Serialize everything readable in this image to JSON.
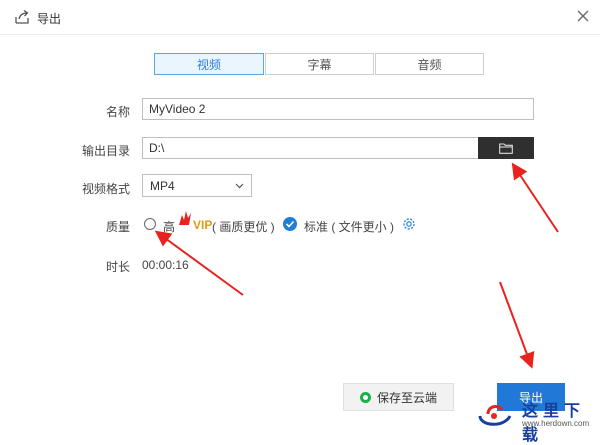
{
  "window": {
    "title": "导出",
    "close_icon": "close-icon",
    "title_icon": "export-icon"
  },
  "tabs": [
    {
      "label": "视频",
      "active": true
    },
    {
      "label": "字幕",
      "active": false
    },
    {
      "label": "音频",
      "active": false
    }
  ],
  "form": {
    "name_label": "名称",
    "name_value": "MyVideo 2",
    "dir_label": "输出目录",
    "dir_value": "D:\\",
    "format_label": "视频格式",
    "format_value": "MP4",
    "quality_label": "质量",
    "quality_high": "高",
    "quality_vip": "VIP",
    "quality_high_note": "( 画质更优 )",
    "quality_standard": "标准 ( 文件更小 )",
    "quality_selected": "standard",
    "duration_label": "时长",
    "duration_value": "00:00:16"
  },
  "footer": {
    "cloud_label": "保存至云端",
    "export_label": "导出"
  },
  "watermark": {
    "text": "这里下载",
    "url": "www.herdown.com"
  },
  "colors": {
    "accent": "#2178d6",
    "tab_active_border": "#58a7e8",
    "annotation_arrow": "#e8231d",
    "cloud_green": "#18b24b",
    "vip_gold": "#e09a16"
  }
}
